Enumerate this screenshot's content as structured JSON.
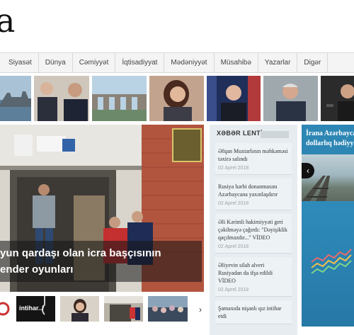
{
  "site": {
    "logo_text": "a"
  },
  "nav": {
    "items": [
      "Siyasət",
      "Dünya",
      "Cəmiyyət",
      "İqtisadiyyat",
      "Mədəniyyət",
      "Müsahibə",
      "Yazarlar",
      "Digər"
    ]
  },
  "hero": {
    "title_line1": "yun qardaşı olan icra başçısının",
    "title_line2": "ender oyunları"
  },
  "bottom_strip": {
    "thumb_caption": "intihar..!"
  },
  "feed": {
    "heading": "XƏBƏR LENTİ",
    "items": [
      {
        "text": "Əfqan Muxtarlının məhkəməsi təxirə salındı",
        "date": "02 Aprel 2018"
      },
      {
        "text": "Rusiya hərbi donanmasını Azərbaycana yaxınlaşdırır",
        "date": "02 Aprel 2018"
      },
      {
        "text": "Əli Kərimli hakimiyyəti geri çəkilməyə çağırdı: \"Dəyişiklik qaçılmazdır...\" VİDEO",
        "date": "02 Aprel 2018"
      },
      {
        "text": "Əliyevin silah alveri Rusiyadan da ifşa edildi VİDEO",
        "date": "02 Aprel 2018"
      },
      {
        "text": "Şamaxıda nişanlı qız intihar etdi",
        "date": ""
      }
    ]
  },
  "banner": {
    "line1": "İrana Azərbaycan",
    "line2": "dollarlıq hədiyy"
  }
}
